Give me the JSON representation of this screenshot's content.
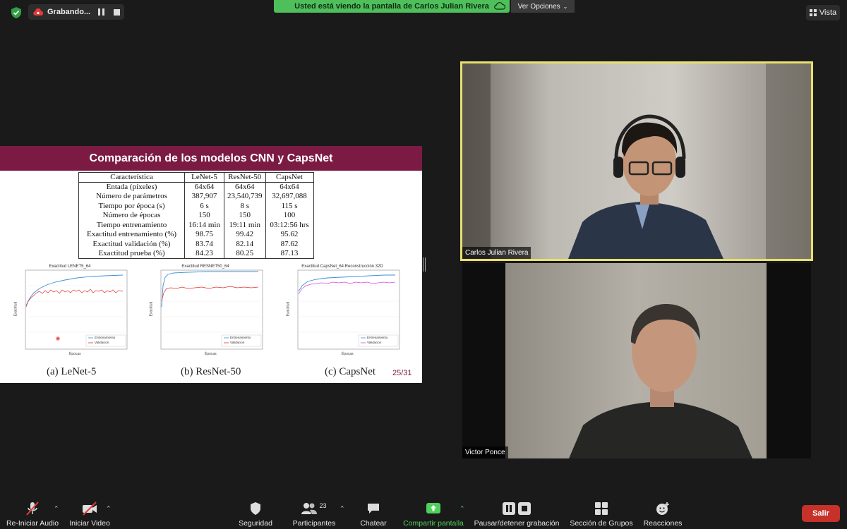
{
  "top_bar": {
    "recording_label": "Grabando...",
    "banner_text": "Usted está viendo la pantalla de Carlos Julian Rivera",
    "view_options_label": "Ver Opciones",
    "vista_label": "Vista"
  },
  "slide": {
    "title": "Comparación de los modelos CNN y CapsNet",
    "table": {
      "headers": [
        "Característica",
        "LeNet-5",
        "ResNet-50",
        "CapsNet"
      ],
      "rows": [
        [
          "Entada (píxeles)",
          "64x64",
          "64x64",
          "64x64"
        ],
        [
          "Número de parámetros",
          "387,907",
          "23,540,739",
          "32,697,088"
        ],
        [
          "Tiempo por época (s)",
          "6 s",
          "8 s",
          "115 s"
        ],
        [
          "Número de épocas",
          "150",
          "150",
          "100"
        ],
        [
          "Tiempo entrenamiento",
          "16:14 min",
          "19:11 min",
          "03:12:56 hrs"
        ],
        [
          "Exactitud entrenamiento (%)",
          "98.75",
          "99.42",
          "95.62"
        ],
        [
          "Exactitud validación (%)",
          "83.74",
          "82.14",
          "87.62"
        ],
        [
          "Exactitud prueba (%)",
          "84.23",
          "80.25",
          "87.13"
        ]
      ]
    },
    "captions": [
      "(a) LeNet-5",
      "(b) ResNet-50",
      "(c) CapsNet"
    ],
    "page": "25/31",
    "chart_titles": [
      "Exactitud LENET5_64",
      "Exactitud RESNET50_64",
      "Exactitud CapsNet_64 Reconstrucción 32D"
    ],
    "chart_xlabel": "Épocas",
    "chart_ylabel": "Exactitud",
    "legend_train": "Entrenamiento",
    "legend_val": "Validacion"
  },
  "participants": {
    "speaker_name": "Carlos Julian Rivera",
    "second_name": "Victor Ponce"
  },
  "toolbar": {
    "audio_label": "Re-Iniciar Audio",
    "video_label": "Iniciar Video",
    "security_label": "Seguridad",
    "participants_label": "Participantes",
    "participants_count": "23",
    "chat_label": "Chatear",
    "share_label": "Compartir pantalla",
    "record_label": "Pausar/detener grabación",
    "groups_label": "Sección de Grupos",
    "reactions_label": "Reacciones",
    "leave_label": "Salir"
  },
  "colors": {
    "banner_green": "#4fbf5c",
    "slide_header": "#7b1a43",
    "leave_red": "#c6312a",
    "share_green": "#4fd05c",
    "speaker_border": "#e8e070"
  }
}
